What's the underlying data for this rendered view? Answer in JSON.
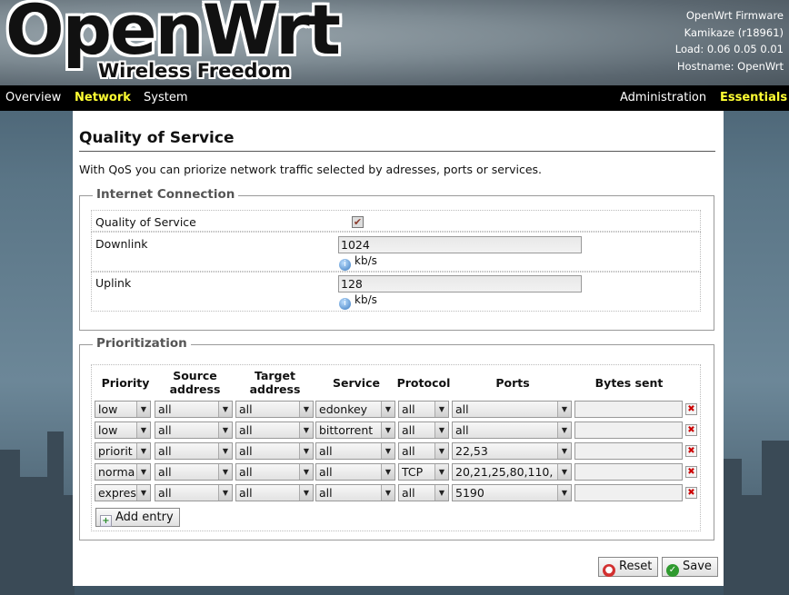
{
  "header": {
    "logo_main": "OpenWrt",
    "logo_sub": "Wireless Freedom",
    "firmware": "OpenWrt Firmware",
    "version": "Kamikaze (r18961)",
    "load": "Load: 0.06 0.05 0.01",
    "hostname": "Hostname: OpenWrt"
  },
  "nav": {
    "left": [
      "Overview",
      "Network",
      "System"
    ],
    "right": [
      "Administration",
      "Essentials"
    ]
  },
  "page": {
    "title": "Quality of Service",
    "description": "With QoS you can priorize network traffic selected by adresses, ports or services."
  },
  "internet": {
    "legend": "Internet Connection",
    "qos_label": "Quality of Service",
    "qos_checked": "✔",
    "downlink_label": "Downlink",
    "downlink_value": "1024",
    "downlink_unit": "kb/s",
    "uplink_label": "Uplink",
    "uplink_value": "128",
    "uplink_unit": "kb/s"
  },
  "prio": {
    "legend": "Prioritization",
    "headers": {
      "priority": "Priority",
      "source": "Source address",
      "target": "Target address",
      "service": "Service",
      "protocol": "Protocol",
      "ports": "Ports",
      "bytes": "Bytes sent"
    },
    "rows": [
      {
        "priority": "low",
        "source": "all",
        "target": "all",
        "service": "edonkey",
        "protocol": "all",
        "ports": "all",
        "bytes": ""
      },
      {
        "priority": "low",
        "source": "all",
        "target": "all",
        "service": "bittorrent",
        "protocol": "all",
        "ports": "all",
        "bytes": ""
      },
      {
        "priority": "priorit",
        "source": "all",
        "target": "all",
        "service": "all",
        "protocol": "all",
        "ports": "22,53",
        "bytes": ""
      },
      {
        "priority": "norma",
        "source": "all",
        "target": "all",
        "service": "all",
        "protocol": "TCP",
        "ports": "20,21,25,80,110,",
        "bytes": ""
      },
      {
        "priority": "expres",
        "source": "all",
        "target": "all",
        "service": "all",
        "protocol": "all",
        "ports": "5190",
        "bytes": ""
      }
    ],
    "add_entry": "Add entry"
  },
  "buttons": {
    "reset": "Reset",
    "save": "Save"
  }
}
